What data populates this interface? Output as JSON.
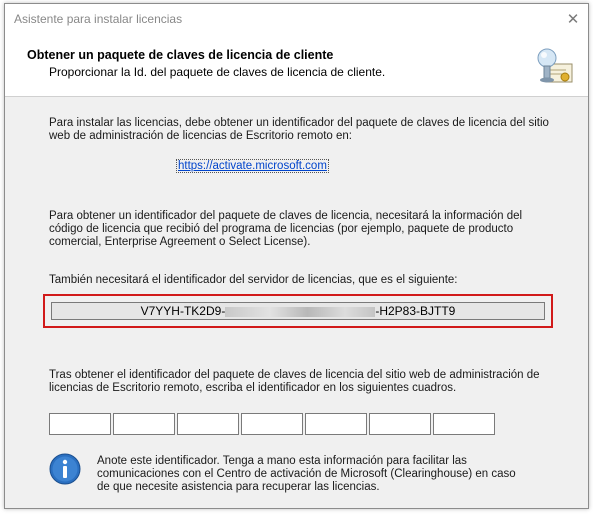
{
  "window": {
    "title": "Asistente para instalar licencias",
    "close_glyph": "✕"
  },
  "header": {
    "title": "Obtener un paquete de claves de licencia de cliente",
    "subtitle": "Proporcionar la Id. del paquete de claves de licencia de cliente.",
    "icon": "certificate-icon"
  },
  "content": {
    "intro": "Para instalar las licencias, debe obtener un identificador del paquete de claves de licencia del sitio web de administración de licencias de Escritorio remoto en:",
    "url": "https://activate.microsoft.com",
    "requirements": "Para obtener un identificador del paquete de claves de licencia, necesitará la información del código de licencia que recibió del programa de licencias (por ejemplo, paquete de producto comercial, Enterprise Agreement o Select License).",
    "server_id_label": "También necesitará el identificador del servidor de licencias, que es el siguiente:",
    "server_id_prefix": "V7YYH-TK2D9-",
    "server_id_suffix": "-H2P83-BJTT9",
    "entry_instructions": "Tras obtener el identificador del paquete de claves de licencia del sitio web de administración de licencias de Escritorio remoto, escriba el identificador en los siguientes cuadros.",
    "note": "Anote este identificador. Tenga a mano esta información para facilitar las comunicaciones con el Centro de activación de Microsoft (Clearinghouse) en caso de que necesite asistencia para recuperar las licencias."
  },
  "colors": {
    "highlight": "#d11a1a",
    "link": "#0044cc",
    "info_blue": "#2a6fc0"
  }
}
